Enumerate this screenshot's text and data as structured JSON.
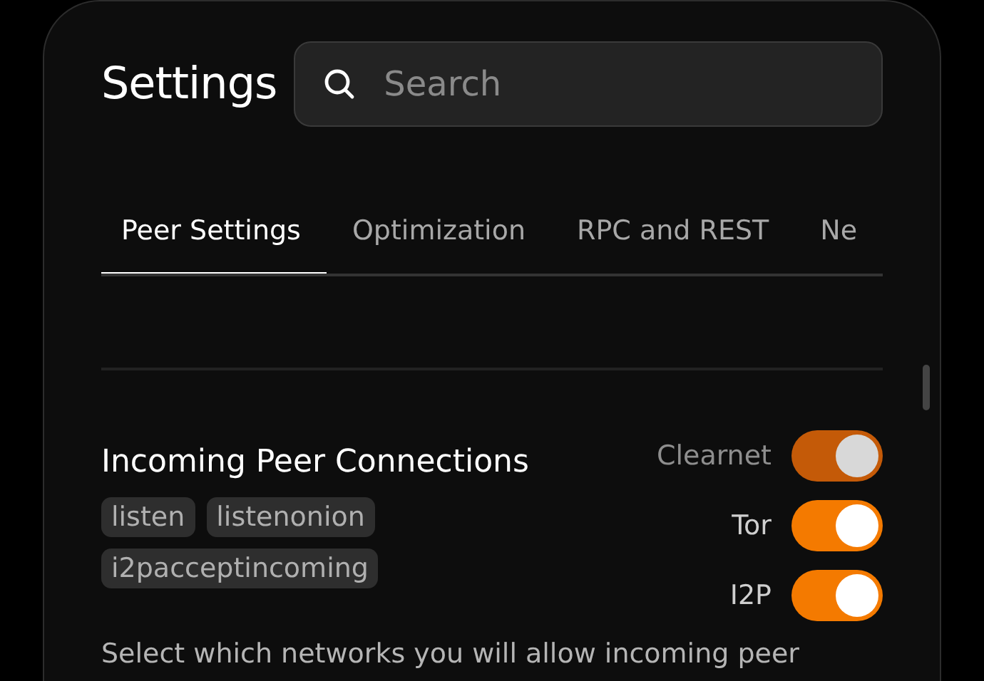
{
  "header": {
    "title": "Settings",
    "search": {
      "placeholder": "Search"
    }
  },
  "tabs": [
    {
      "label": "Peer Settings",
      "selected": true
    },
    {
      "label": "Optimization",
      "selected": false
    },
    {
      "label": "RPC and REST",
      "selected": false
    },
    {
      "label": "Ne",
      "selected": false
    }
  ],
  "section": {
    "title": "Incoming Peer Connections",
    "tags": [
      "listen",
      "listenonion",
      "i2pacceptincoming"
    ],
    "toggles": [
      {
        "label": "Clearnet",
        "on": true,
        "disabled": true
      },
      {
        "label": "Tor",
        "on": true,
        "disabled": false
      },
      {
        "label": "I2P",
        "on": true,
        "disabled": false
      }
    ],
    "description": "Select which networks you will allow incoming peer"
  }
}
